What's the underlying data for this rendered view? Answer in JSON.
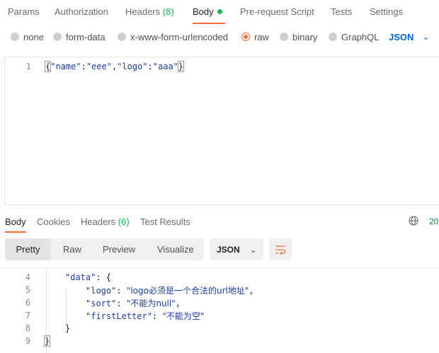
{
  "request_tabs": {
    "params": "Params",
    "authorization": "Authorization",
    "headers": "Headers",
    "headers_count": "(8)",
    "body": "Body",
    "pre_request_script": "Pre-request Script",
    "tests": "Tests",
    "settings": "Settings"
  },
  "body_types": {
    "none": "none",
    "form_data": "form-data",
    "urlencoded": "x-www-form-urlencoded",
    "raw": "raw",
    "binary": "binary",
    "graphql": "GraphQL",
    "format": "JSON",
    "selected": "raw"
  },
  "request_editor": {
    "line_number": "1",
    "open_brace": "{",
    "key1": "\"name\"",
    "val1": "\"eee\"",
    "key2": "\"logo\"",
    "val2": "\"aaa\"",
    "close_brace": "}"
  },
  "response_tabs": {
    "body": "Body",
    "cookies": "Cookies",
    "headers": "Headers",
    "headers_count": "(6)",
    "test_results": "Test Results",
    "status_fragment": "20"
  },
  "response_toolbar": {
    "pretty": "Pretty",
    "raw": "Raw",
    "preview": "Preview",
    "visualize": "Visualize",
    "format": "JSON"
  },
  "response_body": {
    "lines": [
      {
        "n": "4",
        "key": "\"data\"",
        "sep": ": {",
        "val": ""
      },
      {
        "n": "5",
        "key": "\"logo\"",
        "sep": ": ",
        "val": "\"logo必须是一个合法的url地址\"",
        "tail": ","
      },
      {
        "n": "6",
        "key": "\"sort\"",
        "sep": ": ",
        "val": "\"不能为null\"",
        "tail": ","
      },
      {
        "n": "7",
        "key": "\"firstLetter\"",
        "sep": ": ",
        "val": "\"不能为空\"",
        "tail": ""
      },
      {
        "n": "8",
        "key": "",
        "sep": "}",
        "val": ""
      },
      {
        "n": "9",
        "key": "",
        "sep": "}",
        "val": ""
      }
    ]
  },
  "colors": {
    "accent": "#ff6c37",
    "active_dot": "#0cbb52",
    "link_blue": "#0265d2",
    "json_blue": "#1b3ca8"
  }
}
